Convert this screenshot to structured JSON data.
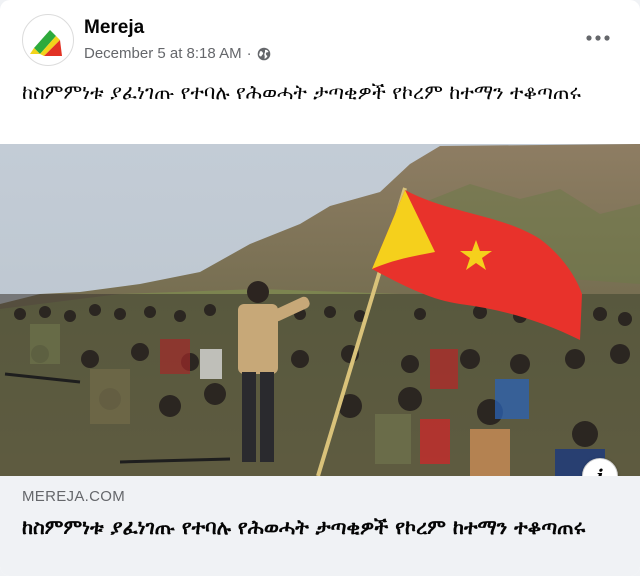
{
  "post": {
    "page_name": "Mereja",
    "timestamp": "December 5 at 8:18 AM",
    "separator": "·",
    "audience_icon": "globe-icon",
    "more_icon": "more-options-icon",
    "text": "ከስምምነቱ ያፈነገጡ የተባሉ የሕወሓት ታጣቂዎች የኮረም ከተማን ተቆጣጠሩ"
  },
  "image": {
    "description_icon": "info-icon",
    "flag_colors": {
      "red": "#e8322b",
      "yellow": "#f5d01c",
      "star": "#f5d01c"
    }
  },
  "link_preview": {
    "domain": "MEREJA.COM",
    "title": "ከስምምነቱ ያፈነገጡ የተባሉ የሕወሓት ታጣቂዎች የኮረም ከተማን ተቆጣጠሩ",
    "info_label": "i"
  },
  "colors": {
    "primary_text": "#050505",
    "secondary_text": "#65676b",
    "preview_bg": "#f0f2f5",
    "logo_green": "#2eaa3c",
    "logo_yellow": "#f2d41a",
    "logo_red": "#e23224"
  }
}
